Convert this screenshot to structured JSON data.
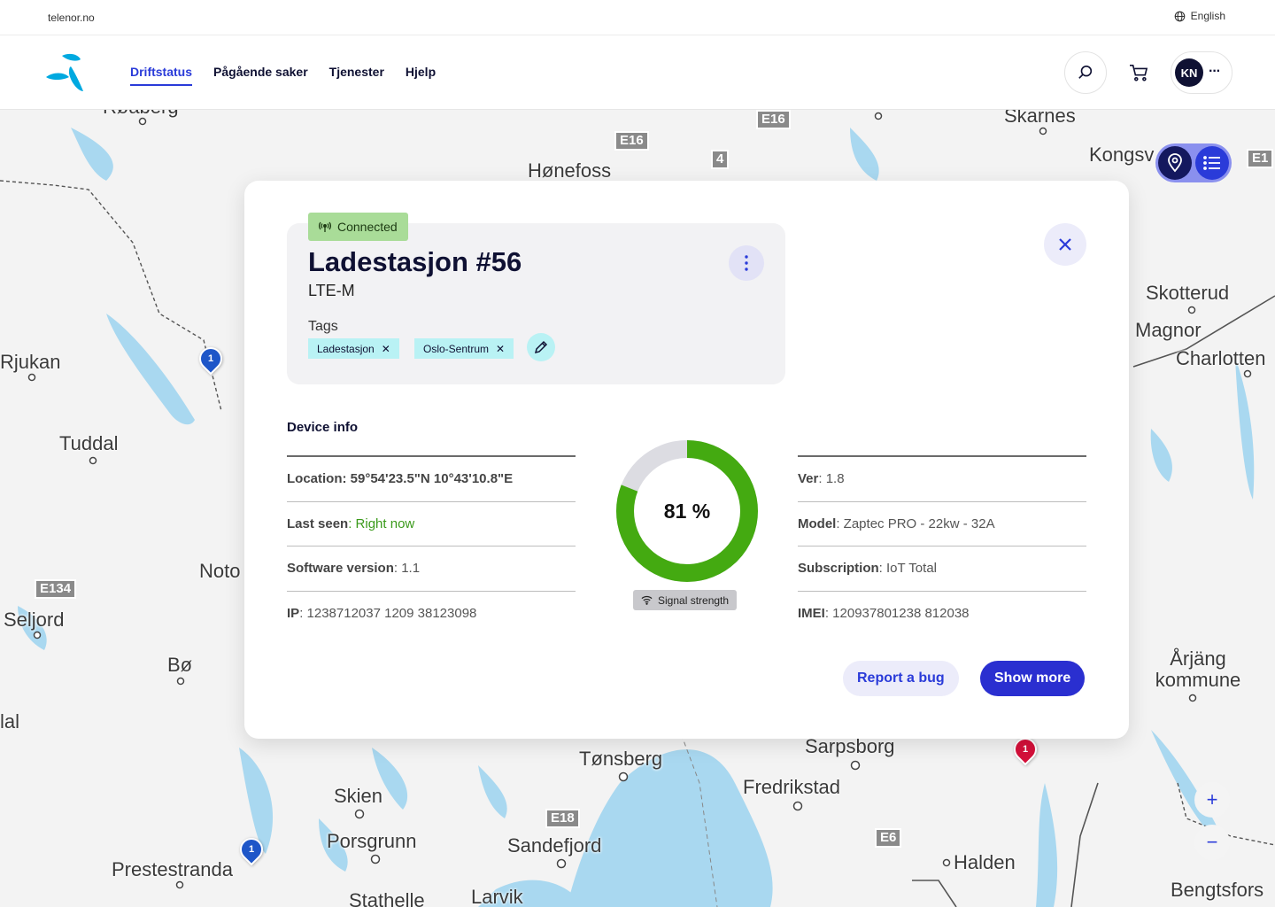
{
  "topbar": {
    "site": "telenor.no",
    "language": "English"
  },
  "nav": {
    "links": [
      "Driftstatus",
      "Pågående saker",
      "Tjenester",
      "Hjelp"
    ],
    "user_initials": "KN",
    "more": "···"
  },
  "map": {
    "places": [
      "Røaberg",
      "Skarnes",
      "Hønefoss",
      "Kongsv",
      "Rjukan",
      "Skotterud",
      "Magnor",
      "Charlotten",
      "Tuddal",
      "Noto",
      "Seljord",
      "Bø",
      "lal",
      "Årjäng kommune",
      "Tønsberg",
      "Sarpsborg",
      "Fredrikstad",
      "Skien",
      "Porsgrunn",
      "Sandefjord",
      "Halden",
      "Prestestranda",
      "Stathelle",
      "Larvik",
      "Bengtsfors"
    ],
    "roads": [
      "E16",
      "E16",
      "4",
      "E134",
      "E18",
      "E6",
      "E1"
    ],
    "markers": [
      "1",
      "1",
      "1"
    ],
    "zoom_in": "+",
    "zoom_out": "−"
  },
  "device": {
    "status": "Connected",
    "title": "Ladestasjon #56",
    "subtitle": "LTE-M",
    "tags_label": "Tags",
    "tags": [
      "Ladestasjon",
      "Oslo-Sentrum"
    ]
  },
  "info": {
    "section_title": "Device info",
    "left": [
      {
        "key": "Location: 59°54'23.5\"N 10°43'10.8\"E",
        "value": "",
        "highlight": false
      },
      {
        "key": "Last seen",
        "value": ": Right now",
        "highlight": true
      },
      {
        "key": "Software version",
        "value": ": 1.1",
        "highlight": false
      },
      {
        "key": "IP",
        "value": ": 1238712037 1209 38123098",
        "highlight": false
      }
    ],
    "right": [
      {
        "key": "Ver",
        "value": ": 1.8"
      },
      {
        "key": "Model",
        "value": ": Zaptec PRO - 22kw - 32A"
      },
      {
        "key": "Subscription",
        "value": ": IoT Total"
      },
      {
        "key": "IMEI",
        "value": ": 120937801238 812038"
      }
    ]
  },
  "signal": {
    "value": 81,
    "label": "81 %",
    "caption": "Signal strength",
    "color": "#44aa11",
    "track_color": "#dcdce2"
  },
  "actions": {
    "report": "Report a bug",
    "show_more": "Show more"
  },
  "colors": {
    "accent": "#2a3bd9",
    "brand": "#00a9e0",
    "connected": "#a9dc98",
    "tag": "#b9f2f4"
  }
}
